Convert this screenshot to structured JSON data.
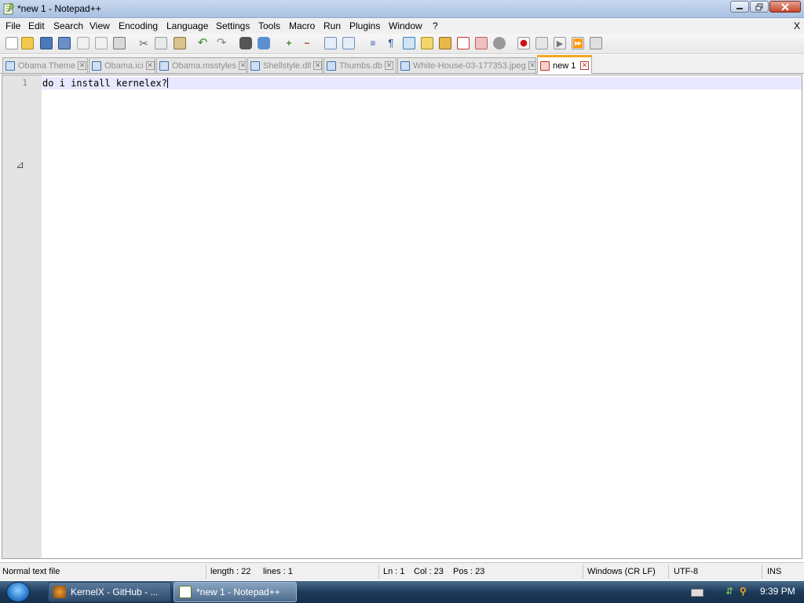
{
  "window": {
    "title": "*new 1 - Notepad++"
  },
  "menu": [
    "File",
    "Edit",
    "Search",
    "View",
    "Encoding",
    "Language",
    "Settings",
    "Tools",
    "Macro",
    "Run",
    "Plugins",
    "Window",
    "?"
  ],
  "menu_close": "X",
  "toolbar_icons": [
    "new-file-icon",
    "open-file-icon",
    "save-icon",
    "save-all-icon",
    "close-icon",
    "close-all-icon",
    "print-icon",
    "cut-icon",
    "copy-icon",
    "paste-icon",
    "undo-icon",
    "redo-icon",
    "find-icon",
    "replace-icon",
    "zoom-in-icon",
    "zoom-out-icon",
    "sync-vertical-icon",
    "sync-horizontal-icon",
    "word-wrap-icon",
    "show-all-chars-icon",
    "indent-guide-icon",
    "user-language-icon",
    "doc-map-icon",
    "function-list-icon",
    "folder-workspace-icon",
    "record-macro-icon",
    "stop-recording-icon",
    "play-macro-icon",
    "run-macro-multiple-icon",
    "save-macro-icon"
  ],
  "tabs": [
    {
      "label": "Obama Theme",
      "active": false
    },
    {
      "label": "Obama.ici",
      "active": false
    },
    {
      "label": "Obama.msstyles",
      "active": false
    },
    {
      "label": "Shellstyle.dll",
      "active": false
    },
    {
      "label": "Thumbs.db",
      "active": false
    },
    {
      "label": "White-House-03-177353.jpeg",
      "active": false
    },
    {
      "label": "new 1",
      "active": true
    }
  ],
  "editor": {
    "line_number": "1",
    "content": "do i install kernelex?"
  },
  "status": {
    "filetype": "Normal text file",
    "length": "length : 22",
    "lines": "lines : 1",
    "ln": "Ln : 1",
    "col": "Col : 23",
    "pos": "Pos : 23",
    "eol": "Windows (CR LF)",
    "encoding": "UTF-8",
    "mode": "INS"
  },
  "taskbar": {
    "items": [
      {
        "label": "KernelX - GitHub - ...",
        "active": false
      },
      {
        "label": "*new 1 - Notepad++",
        "active": true
      }
    ],
    "clock": "9:39 PM"
  },
  "colors": {
    "accent_tab": "#f5a623",
    "current_line": "#e8e8ff",
    "taskbar": "#1d3a58"
  }
}
